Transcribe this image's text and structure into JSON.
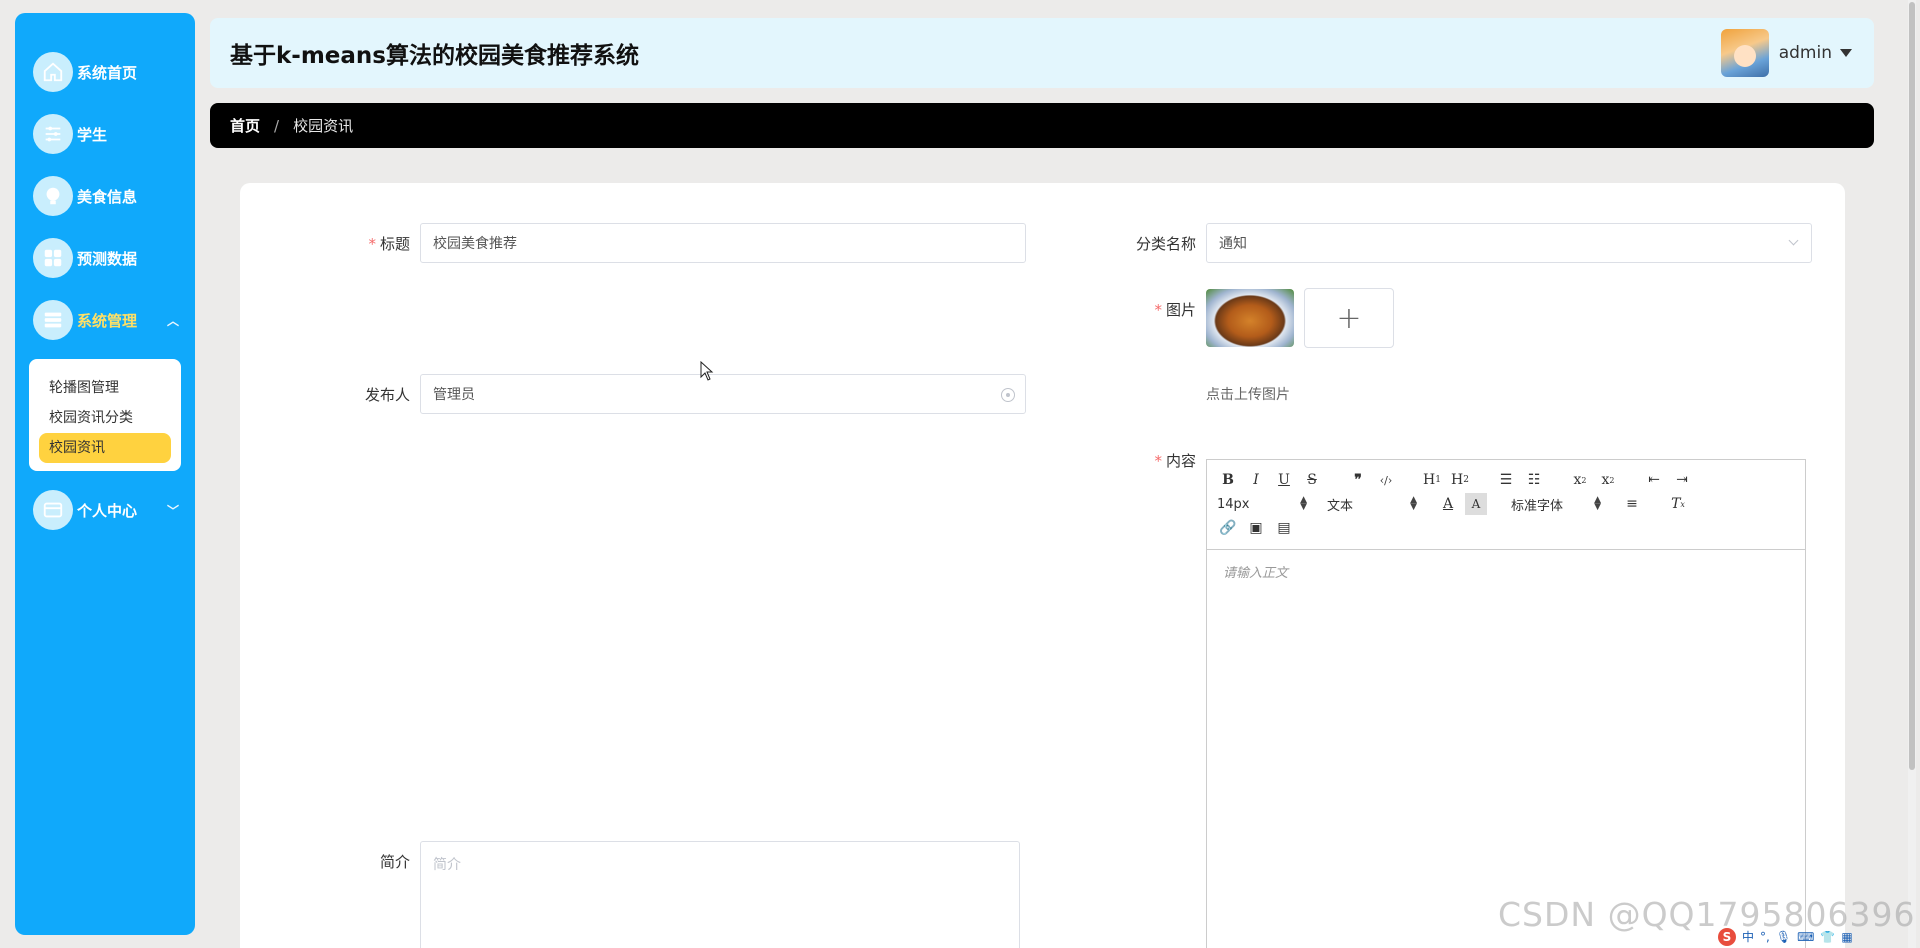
{
  "sidebar": {
    "items": [
      {
        "label": "系统首页",
        "icon": "home-icon"
      },
      {
        "label": "学生",
        "icon": "sliders-icon"
      },
      {
        "label": "美食信息",
        "icon": "bulb-icon"
      },
      {
        "label": "预测数据",
        "icon": "grid-icon"
      },
      {
        "label": "系统管理",
        "icon": "menu-icon",
        "expanded": true
      },
      {
        "label": "个人中心",
        "icon": "card-icon"
      }
    ],
    "submenu": [
      {
        "label": "轮播图管理"
      },
      {
        "label": "校园资讯分类"
      },
      {
        "label": "校园资讯",
        "selected": true
      }
    ]
  },
  "header": {
    "title": "基于k-means算法的校园美食推荐系统",
    "username": "admin"
  },
  "breadcrumb": {
    "home": "首页",
    "separator": "/",
    "current": "校园资讯"
  },
  "form": {
    "title_label": "标题",
    "title_value": "校园美食推荐",
    "category_label": "分类名称",
    "category_value": "通知",
    "image_label": "图片",
    "upload_hint": "点击上传图片",
    "publisher_label": "发布人",
    "publisher_value": "管理员",
    "content_label": "内容",
    "content_placeholder": "请输入正文",
    "summary_label": "简介",
    "summary_placeholder": "简介"
  },
  "editor": {
    "font_size": "14px",
    "paragraph": "文本",
    "font_family": "标准字体"
  },
  "watermark": "CSDN @QQ1795806396",
  "tray": {
    "ime": "中"
  },
  "colors": {
    "sidebar_bg": "#10a9fb",
    "header_bg": "#e3f6fd",
    "breadcrumb_bg": "#000000",
    "selected_item": "#ffd23f",
    "required": "#f56c6c"
  }
}
